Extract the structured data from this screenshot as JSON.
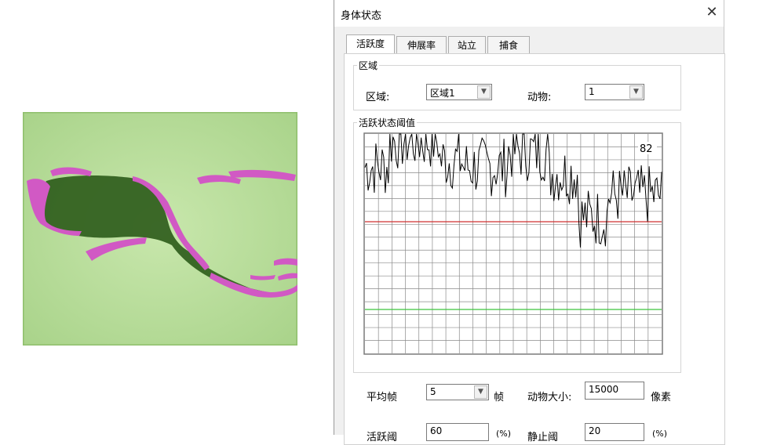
{
  "dialog": {
    "title": "身体状态",
    "close_glyph": "✕",
    "tabs": [
      {
        "label": "活跃度",
        "active": true
      },
      {
        "label": "伸展率",
        "active": false
      },
      {
        "label": "站立",
        "active": false
      },
      {
        "label": "捕食",
        "active": false
      }
    ],
    "region_group": {
      "title": "区域",
      "region_label": "区域:",
      "region_value": "区域1",
      "animal_label": "动物:",
      "animal_value": "1"
    },
    "threshold_group": {
      "title": "活跃状态阈值",
      "current_value": "82",
      "red_threshold_percent": 60,
      "green_threshold_percent": 20,
      "line_color": "#000000",
      "red_line_color": "#d03030",
      "green_line_color": "#3cc43c"
    },
    "settings": {
      "avg_frame_label": "平均帧",
      "avg_frame_value": "5",
      "frame_unit": "帧",
      "animal_size_label": "动物大小:",
      "animal_size_value": "15000",
      "pixel_unit": "像素",
      "active_label": "活跃阈",
      "active_value": "60",
      "active_unit": "(%)",
      "rest_label": "静止阈",
      "rest_value": "20",
      "rest_unit": "(%)"
    }
  },
  "video": {
    "background_color": "#c3e3a6",
    "animal_color": "#2f5d1c",
    "highlight_color": "#d159c4"
  }
}
